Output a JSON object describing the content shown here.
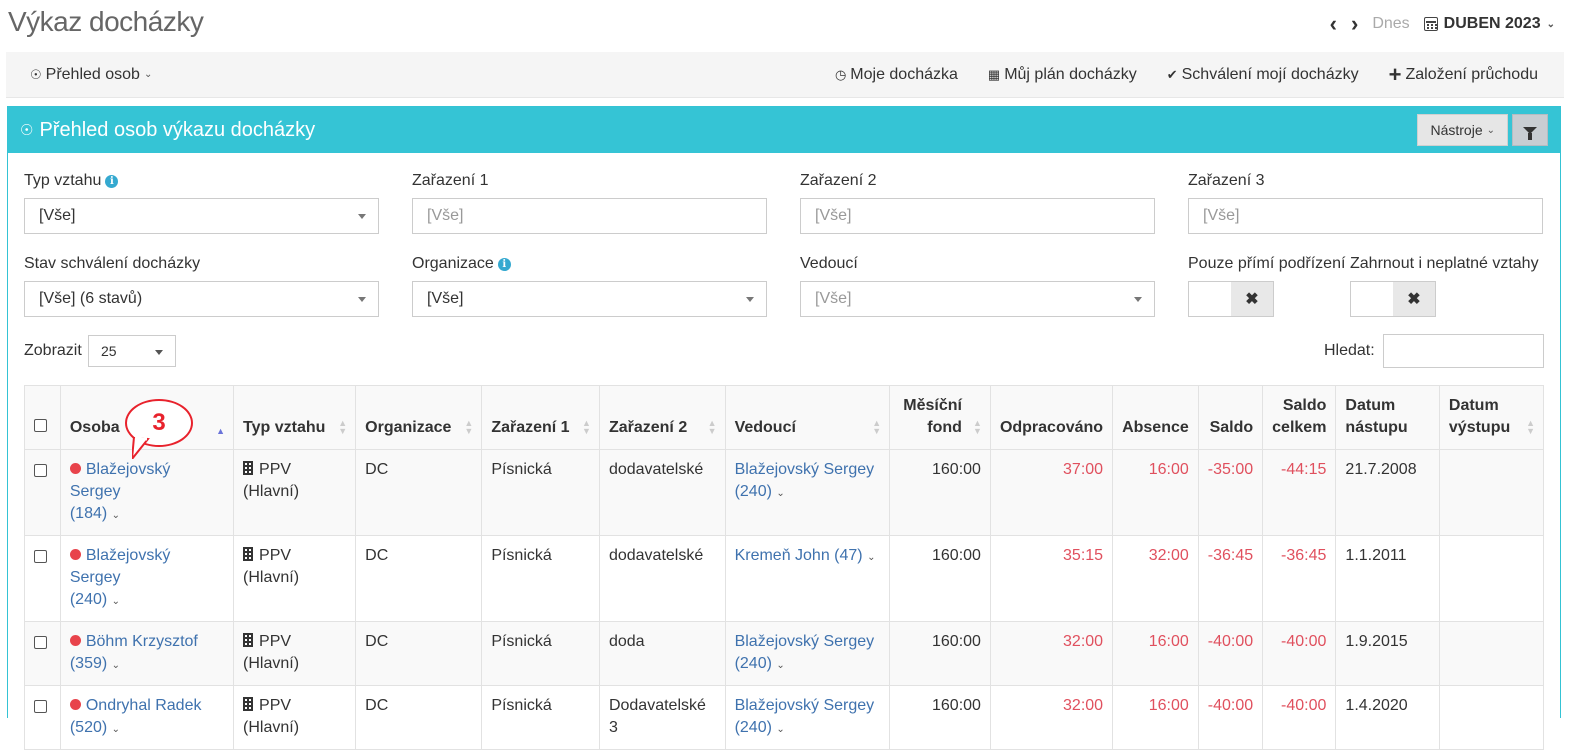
{
  "page": {
    "title": "Výkaz docházky"
  },
  "date_nav": {
    "prev": "‹",
    "next": "›",
    "today": "Dnes",
    "month": "DUBEN 2023"
  },
  "toolbar": {
    "left": "Přehled osob",
    "items": [
      "Moje docházka",
      "Můj plán docházky",
      "Schválení mojí docházky",
      "Založení průchodu"
    ]
  },
  "panel": {
    "title": "Přehled osob výkazu docházky",
    "tools": "Nástroje"
  },
  "filters": {
    "typ_vztahu": {
      "label": "Typ vztahu",
      "value": "[Vše]"
    },
    "zarazeni1": {
      "label": "Zařazení 1",
      "placeholder": "[Vše]"
    },
    "zarazeni2": {
      "label": "Zařazení 2",
      "placeholder": "[Vše]"
    },
    "zarazeni3": {
      "label": "Zařazení 3",
      "placeholder": "[Vše]"
    },
    "stav": {
      "label": "Stav schválení docházky",
      "value": "[Vše] (6 stavů)"
    },
    "organizace": {
      "label": "Organizace",
      "value": "[Vše]"
    },
    "vedouci": {
      "label": "Vedoucí",
      "placeholder": "[Vše]"
    },
    "pouze_primi": {
      "label": "Pouze přímí podřízení"
    },
    "zahrnout": {
      "label": "Zahrnout i neplatné vztahy"
    }
  },
  "list": {
    "show_label": "Zobrazit",
    "page_size": "25",
    "search_label": "Hledat:"
  },
  "columns": {
    "osoba": "Osoba",
    "typ_vztahu": "Typ vztahu",
    "organizace": "Organizace",
    "zarazeni1": "Zařazení 1",
    "zarazeni2": "Zařazení 2",
    "vedouci": "Vedoucí",
    "mesicni_fond_1": "Měsíční",
    "mesicni_fond_2": "fond",
    "odpracovano": "Odpracováno",
    "absence": "Absence",
    "saldo": "Saldo",
    "saldo_celkem_1": "Saldo",
    "saldo_celkem_2": "celkem",
    "datum_nastupu_1": "Datum",
    "datum_nastupu_2": "nástupu",
    "datum_vystupu_1": "Datum",
    "datum_vystupu_2": "výstupu"
  },
  "rows": [
    {
      "name": "Blažejovský Sergey",
      "id": "(184)",
      "typ": "PPV (Hlavní)",
      "org": "DC",
      "z1": "Písnická",
      "z2": "dodavatelské",
      "ved": "Blažejovský Sergey",
      "ved_id": "(240)",
      "fond": "160:00",
      "odpr": "37:00",
      "abs": "16:00",
      "saldo": "-35:00",
      "saldo_c": "-44:15",
      "nastup": "21.7.2008",
      "vystup": ""
    },
    {
      "name": "Blažejovský Sergey",
      "id": "(240)",
      "typ": "PPV (Hlavní)",
      "org": "DC",
      "z1": "Písnická",
      "z2": "dodavatelské",
      "ved": "Kremeň John (47)",
      "ved_id": "",
      "fond": "160:00",
      "odpr": "35:15",
      "abs": "32:00",
      "saldo": "-36:45",
      "saldo_c": "-36:45",
      "nastup": "1.1.2011",
      "vystup": ""
    },
    {
      "name": "Böhm Krzysztof",
      "id": "(359)",
      "typ": "PPV (Hlavní)",
      "org": "DC",
      "z1": "Písnická",
      "z2": "doda",
      "ved": "Blažejovský Sergey",
      "ved_id": "(240)",
      "fond": "160:00",
      "odpr": "32:00",
      "abs": "16:00",
      "saldo": "-40:00",
      "saldo_c": "-40:00",
      "nastup": "1.9.2015",
      "vystup": ""
    },
    {
      "name": "Ondryhal Radek",
      "id": "(520)",
      "typ": "PPV (Hlavní)",
      "org": "DC",
      "z1": "Písnická",
      "z2": "Dodavatelské 3",
      "ved": "Blažejovský Sergey",
      "ved_id": "(240)",
      "fond": "160:00",
      "odpr": "32:00",
      "abs": "16:00",
      "saldo": "-40:00",
      "saldo_c": "-40:00",
      "nastup": "1.4.2020",
      "vystup": ""
    }
  ],
  "annotation": {
    "step": "3"
  }
}
